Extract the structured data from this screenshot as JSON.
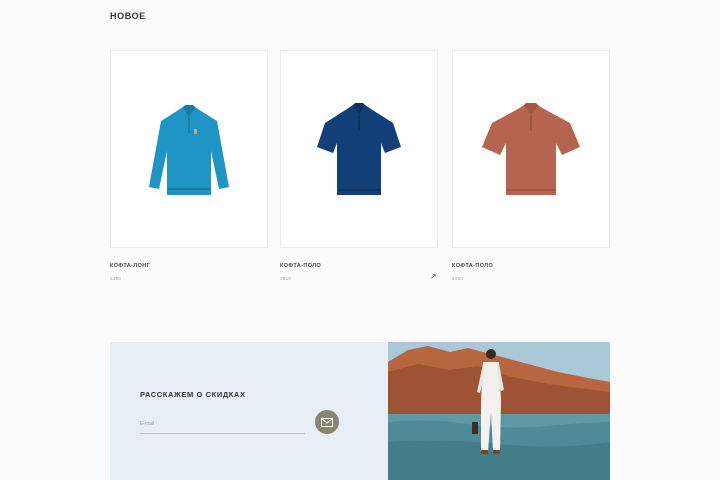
{
  "section": {
    "title": "НОВОЕ"
  },
  "products": [
    {
      "name": "КОФТА-ЛОНГ",
      "price": "5490",
      "color": "#1e95c4"
    },
    {
      "name": "КОФТА-ПОЛО",
      "price": "3610",
      "color": "#123f78"
    },
    {
      "name": "КОФТА-ПОЛО",
      "price": "3490",
      "color": "#b5654f"
    }
  ],
  "newsletter": {
    "title": "РАССКАЖЕМ О СКИДКАХ",
    "email_placeholder": "E-mail",
    "submit_icon": "envelope-icon"
  },
  "colors": {
    "promo_bg": "#e8eef5",
    "button": "#8b8470"
  }
}
